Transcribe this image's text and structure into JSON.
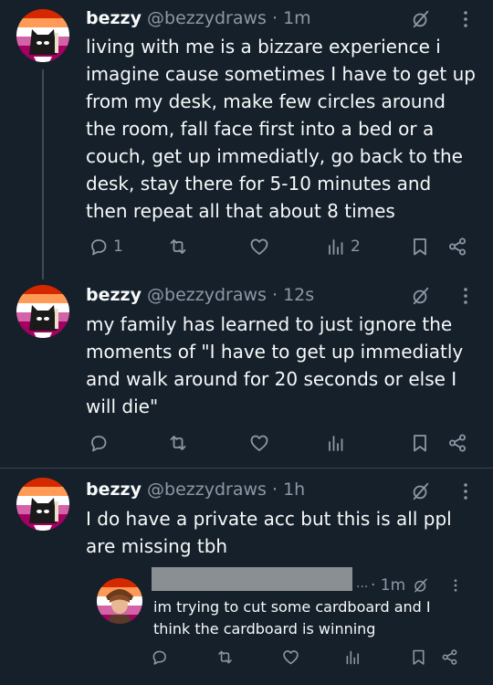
{
  "tweets": [
    {
      "name": "bezzy",
      "handle": "@bezzydraws",
      "separator": "·",
      "time": "1m",
      "text": "living with me is a bizzare experience i imagine cause sometimes I have to get up from my desk, make few circles around the room, fall face first into a bed or a couch, get up immediatly, go back to the desk, stay there for 5-10 minutes and then repeat all that about 8 times",
      "replies": "1",
      "views": "2"
    },
    {
      "name": "bezzy",
      "handle": "@bezzydraws",
      "separator": "·",
      "time": "12s",
      "text": "my family has learned to just ignore the moments of \"I have to get up immediatly and walk around for 20 seconds or else I will die\"",
      "replies": "",
      "views": ""
    },
    {
      "name": "bezzy",
      "handle": "@bezzydraws",
      "separator": "·",
      "time": "1h",
      "text": "I do have a private acc but this is all ppl are missing tbh",
      "replies": "",
      "views": ""
    }
  ],
  "quoted": {
    "dots": "...",
    "time": "· 1m",
    "text": "im trying to cut some cardboard and I think the cardboard is winning"
  },
  "icons": {
    "reply": "reply-icon",
    "retweet": "retweet-icon",
    "like": "like-icon",
    "views": "views-icon",
    "bookmark": "bookmark-icon",
    "share": "share-icon",
    "grok": "grok-icon",
    "more": "more-icon"
  },
  "colors": {
    "background": "#15202b",
    "text": "#f7f9f9",
    "muted": "#8b98a5",
    "divider": "#38444d"
  }
}
